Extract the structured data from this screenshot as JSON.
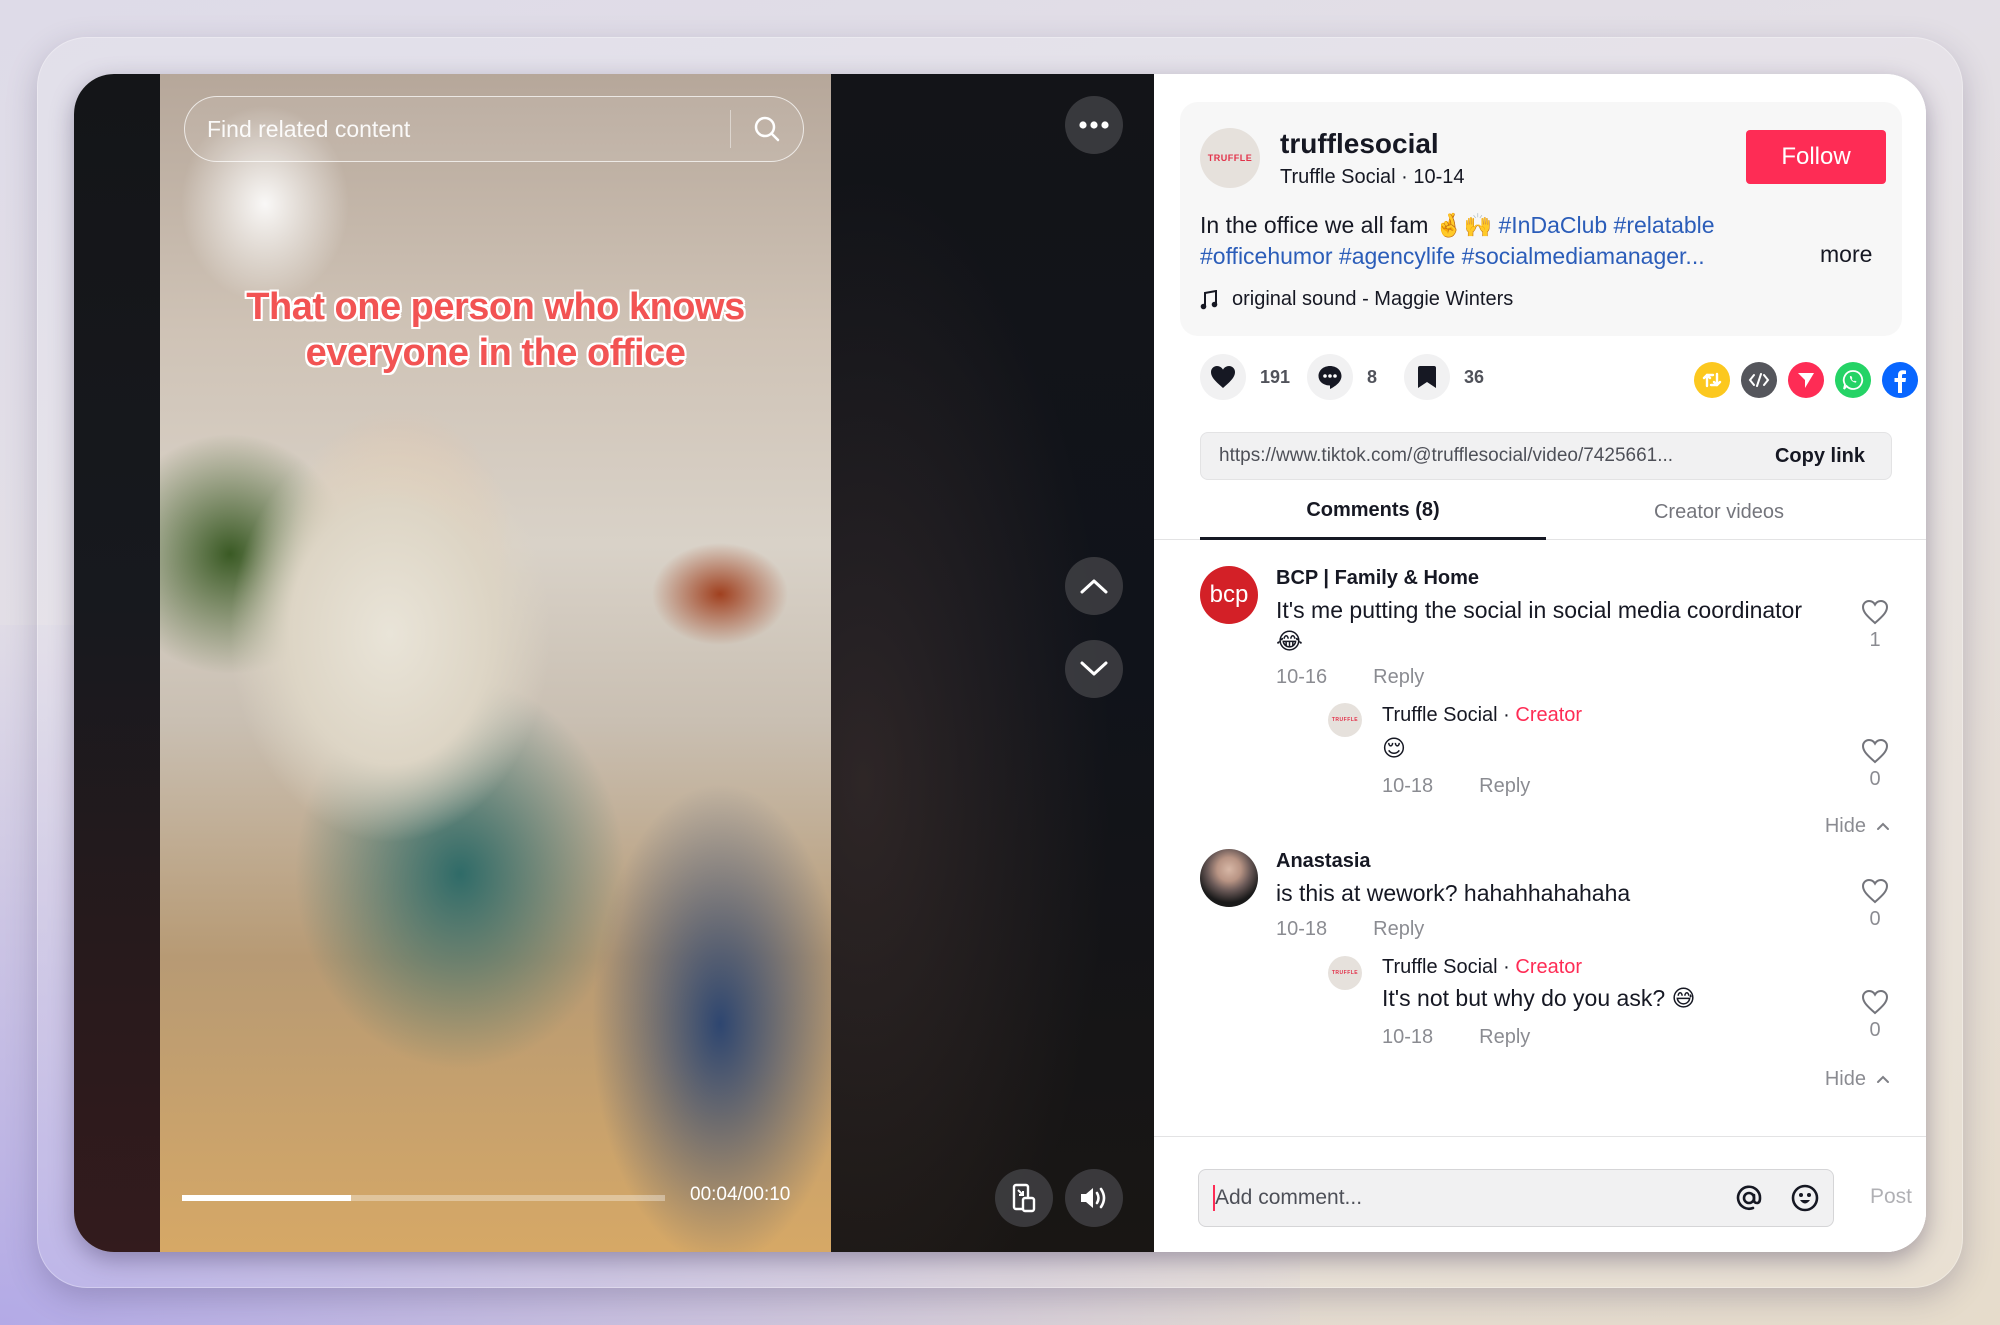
{
  "video": {
    "search_placeholder": "Find related content",
    "caption_line1": "That one person who knows",
    "caption_line2": "everyone in the office",
    "time_current": "00:04",
    "time_total": "00:10",
    "time_readout": "00:04/00:10",
    "progress_fraction": 0.35,
    "icons": {
      "search": "search-icon",
      "more": "more-options-icon",
      "prev": "chevron-up-icon",
      "next": "chevron-down-icon",
      "pip": "floating-player-icon",
      "volume": "volume-icon"
    }
  },
  "post": {
    "avatar_text": "TRUFFLE",
    "username": "trufflesocial",
    "display_name": "Truffle Social",
    "date": "10-14",
    "subline": "Truffle Social · 10-14",
    "follow_label": "Follow",
    "description_text": "In the office we all fam 🤞🙌 ",
    "hashtags_line1": "#InDaClub #relatable",
    "hashtags_line2": "#officehumor #agencylife #socialmediamanager...",
    "more_label": "more",
    "sound": "original sound - Maggie Winters",
    "brand_color": "#fe2c55",
    "hashtag_color": "#2b5db9"
  },
  "stats": {
    "likes": "191",
    "comments": "8",
    "saves": "36"
  },
  "share": [
    {
      "name": "repost",
      "icon": "repost-icon",
      "color": "#fcc81f"
    },
    {
      "name": "embed",
      "icon": "embed-code-icon",
      "color": "#55565c"
    },
    {
      "name": "send-to-friends",
      "icon": "paper-plane-icon",
      "color": "#fe2c55"
    },
    {
      "name": "whatsapp",
      "icon": "whatsapp-icon",
      "color": "#25d366"
    },
    {
      "name": "facebook",
      "icon": "facebook-icon",
      "color": "#0866ff"
    },
    {
      "name": "more-share",
      "icon": "share-arrow-icon",
      "color": "#161823"
    }
  ],
  "link": {
    "url": "https://www.tiktok.com/@trufflesocial/video/7425661...",
    "copy_label": "Copy link"
  },
  "tabs": [
    {
      "label": "Comments (8)",
      "active": true
    },
    {
      "label": "Creator videos",
      "active": false
    }
  ],
  "comments": [
    {
      "author": "BCP | Family & Home",
      "avatar_text": "bcp",
      "text": "It's me putting the social in social media coordinator 😂",
      "date": "10-16",
      "reply_label": "Reply",
      "likes": "1",
      "replies": [
        {
          "author": "Truffle Social",
          "badge": "Creator",
          "text": "😌",
          "date": "10-18",
          "reply_label": "Reply",
          "likes": "0"
        }
      ],
      "hide_label": "Hide"
    },
    {
      "author": "Anastasia",
      "text": "is this at wework? hahahhahahaha",
      "date": "10-18",
      "reply_label": "Reply",
      "likes": "0",
      "replies": [
        {
          "author": "Truffle Social",
          "badge": "Creator",
          "text": "It's not but why do you ask? 😅",
          "date": "10-18",
          "reply_label": "Reply",
          "likes": "0"
        }
      ],
      "hide_label": "Hide"
    }
  ],
  "composer": {
    "placeholder": "Add comment...",
    "post_label": "Post"
  }
}
